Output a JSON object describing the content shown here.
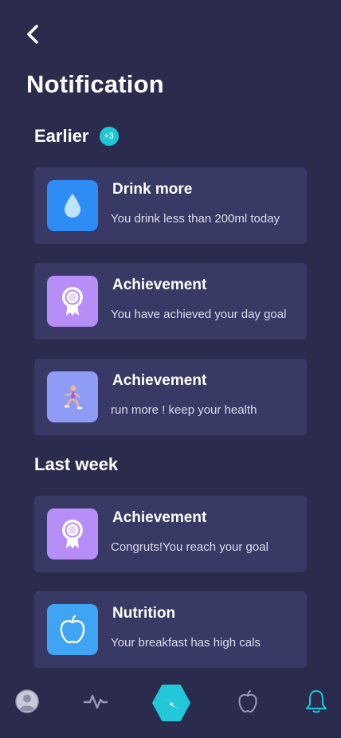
{
  "header": {
    "back_icon": "chevron-left-icon",
    "title": "Notification"
  },
  "sections": {
    "earlier": {
      "label": "Earlier",
      "badge": "+3"
    },
    "last_week": {
      "label": "Last week"
    }
  },
  "notifications": [
    {
      "title": "Drink more",
      "message": "You drink less than 200ml today",
      "icon": "water-drop-icon",
      "icon_bg": "#2d8cf5"
    },
    {
      "title": "Achievement",
      "message": "You have achieved your day goal",
      "icon": "award-ribbon-icon",
      "icon_bg": "#b78df7"
    },
    {
      "title": "Achievement",
      "message": "run more ! keep your health",
      "icon": "runner-icon",
      "icon_bg": "#8f9cf5"
    },
    {
      "title": "Achievement",
      "message": "Congruts!You reach your goal",
      "icon": "award-ribbon-icon",
      "icon_bg": "#b78df7"
    },
    {
      "title": "Nutrition",
      "message": "Your breakfast has high cals",
      "icon": "apple-icon",
      "icon_bg": "#3fa4f4"
    }
  ],
  "tab_bar": {
    "tabs": [
      {
        "name": "profile",
        "icon": "user-avatar-icon",
        "active": false
      },
      {
        "name": "activity",
        "icon": "pulse-icon",
        "active": false
      },
      {
        "name": "home",
        "icon": "lightning-hexagon-icon",
        "active": false
      },
      {
        "name": "nutrition",
        "icon": "apple-outline-icon",
        "active": false
      },
      {
        "name": "notifications",
        "icon": "bell-icon",
        "active": true
      }
    ],
    "active_color": "#22c7d9",
    "inactive_color": "#9a9ab8"
  },
  "colors": {
    "background": "#2b2b4e",
    "card": "#393965",
    "accent": "#1fc7d6"
  }
}
